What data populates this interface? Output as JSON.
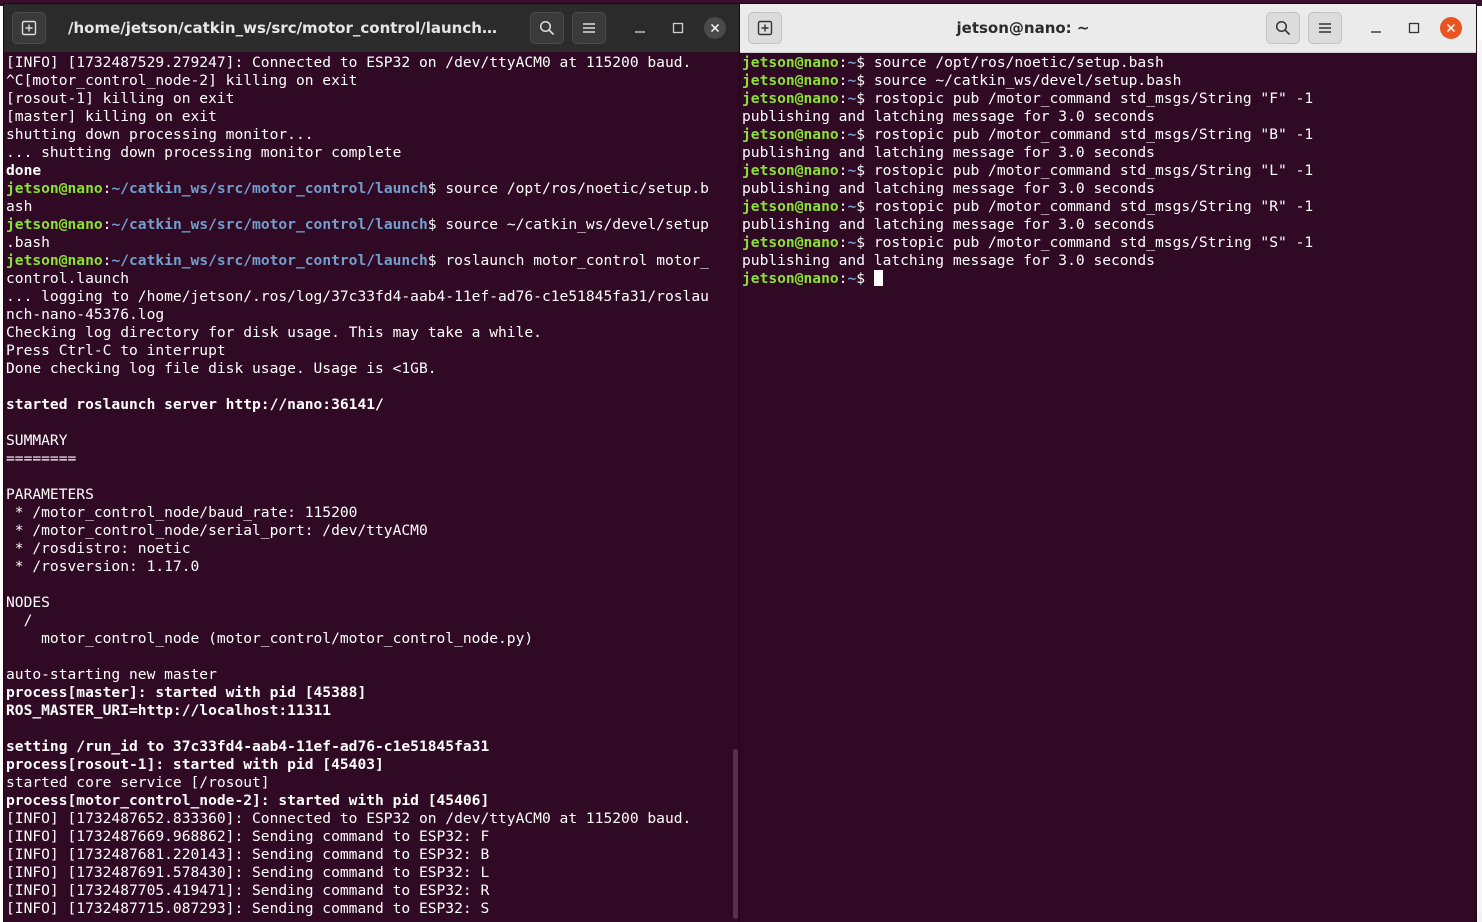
{
  "left_window": {
    "title": "/home/jetson/catkin_ws/src/motor_control/launch/motor_c...",
    "lines": [
      {
        "t": "text",
        "s": "[INFO] [1732487529.279247]: Connected to ESP32 on /dev/ttyACM0 at 115200 baud."
      },
      {
        "t": "text",
        "s": "^C[motor_control_node-2] killing on exit"
      },
      {
        "t": "text",
        "s": "[rosout-1] killing on exit"
      },
      {
        "t": "text",
        "s": "[master] killing on exit"
      },
      {
        "t": "text",
        "s": "shutting down processing monitor..."
      },
      {
        "t": "text",
        "s": "... shutting down processing monitor complete"
      },
      {
        "t": "bold",
        "s": "done"
      },
      {
        "t": "prompt",
        "user": "jetson@nano",
        "path": "~/catkin_ws/src/motor_control/launch",
        "cmd": " source /opt/ros/noetic/setup.b"
      },
      {
        "t": "text",
        "s": "ash"
      },
      {
        "t": "prompt",
        "user": "jetson@nano",
        "path": "~/catkin_ws/src/motor_control/launch",
        "cmd": " source ~/catkin_ws/devel/setup"
      },
      {
        "t": "text",
        "s": ".bash"
      },
      {
        "t": "prompt",
        "user": "jetson@nano",
        "path": "~/catkin_ws/src/motor_control/launch",
        "cmd": " roslaunch motor_control motor_"
      },
      {
        "t": "text",
        "s": "control.launch"
      },
      {
        "t": "text",
        "s": "... logging to /home/jetson/.ros/log/37c33fd4-aab4-11ef-ad76-c1e51845fa31/roslau"
      },
      {
        "t": "text",
        "s": "nch-nano-45376.log"
      },
      {
        "t": "text",
        "s": "Checking log directory for disk usage. This may take a while."
      },
      {
        "t": "text",
        "s": "Press Ctrl-C to interrupt"
      },
      {
        "t": "text",
        "s": "Done checking log file disk usage. Usage is <1GB."
      },
      {
        "t": "text",
        "s": ""
      },
      {
        "t": "bold",
        "s": "started roslaunch server http://nano:36141/"
      },
      {
        "t": "text",
        "s": ""
      },
      {
        "t": "text",
        "s": "SUMMARY"
      },
      {
        "t": "text",
        "s": "========"
      },
      {
        "t": "text",
        "s": ""
      },
      {
        "t": "text",
        "s": "PARAMETERS"
      },
      {
        "t": "text",
        "s": " * /motor_control_node/baud_rate: 115200"
      },
      {
        "t": "text",
        "s": " * /motor_control_node/serial_port: /dev/ttyACM0"
      },
      {
        "t": "text",
        "s": " * /rosdistro: noetic"
      },
      {
        "t": "text",
        "s": " * /rosversion: 1.17.0"
      },
      {
        "t": "text",
        "s": ""
      },
      {
        "t": "text",
        "s": "NODES"
      },
      {
        "t": "text",
        "s": "  /"
      },
      {
        "t": "text",
        "s": "    motor_control_node (motor_control/motor_control_node.py)"
      },
      {
        "t": "text",
        "s": ""
      },
      {
        "t": "text",
        "s": "auto-starting new master"
      },
      {
        "t": "bold",
        "s": "process[master]: started with pid [45388]"
      },
      {
        "t": "bold",
        "s": "ROS_MASTER_URI=http://localhost:11311"
      },
      {
        "t": "text",
        "s": ""
      },
      {
        "t": "bold",
        "s": "setting /run_id to 37c33fd4-aab4-11ef-ad76-c1e51845fa31"
      },
      {
        "t": "bold",
        "s": "process[rosout-1]: started with pid [45403]"
      },
      {
        "t": "text",
        "s": "started core service [/rosout]"
      },
      {
        "t": "bold",
        "s": "process[motor_control_node-2]: started with pid [45406]"
      },
      {
        "t": "text",
        "s": "[INFO] [1732487652.833360]: Connected to ESP32 on /dev/ttyACM0 at 115200 baud."
      },
      {
        "t": "text",
        "s": "[INFO] [1732487669.968862]: Sending command to ESP32: F"
      },
      {
        "t": "text",
        "s": "[INFO] [1732487681.220143]: Sending command to ESP32: B"
      },
      {
        "t": "text",
        "s": "[INFO] [1732487691.578430]: Sending command to ESP32: L"
      },
      {
        "t": "text",
        "s": "[INFO] [1732487705.419471]: Sending command to ESP32: R"
      },
      {
        "t": "text",
        "s": "[INFO] [1732487715.087293]: Sending command to ESP32: S"
      }
    ]
  },
  "right_window": {
    "title": "jetson@nano: ~",
    "lines": [
      {
        "t": "prompt",
        "user": "jetson@nano",
        "path": "~",
        "cmd": " source /opt/ros/noetic/setup.bash"
      },
      {
        "t": "prompt",
        "user": "jetson@nano",
        "path": "~",
        "cmd": " source ~/catkin_ws/devel/setup.bash"
      },
      {
        "t": "prompt",
        "user": "jetson@nano",
        "path": "~",
        "cmd": " rostopic pub /motor_command std_msgs/String \"F\" -1"
      },
      {
        "t": "text",
        "s": "publishing and latching message for 3.0 seconds"
      },
      {
        "t": "prompt",
        "user": "jetson@nano",
        "path": "~",
        "cmd": " rostopic pub /motor_command std_msgs/String \"B\" -1"
      },
      {
        "t": "text",
        "s": "publishing and latching message for 3.0 seconds"
      },
      {
        "t": "prompt",
        "user": "jetson@nano",
        "path": "~",
        "cmd": " rostopic pub /motor_command std_msgs/String \"L\" -1"
      },
      {
        "t": "text",
        "s": "publishing and latching message for 3.0 seconds"
      },
      {
        "t": "prompt",
        "user": "jetson@nano",
        "path": "~",
        "cmd": " rostopic pub /motor_command std_msgs/String \"R\" -1"
      },
      {
        "t": "text",
        "s": "publishing and latching message for 3.0 seconds"
      },
      {
        "t": "prompt",
        "user": "jetson@nano",
        "path": "~",
        "cmd": " rostopic pub /motor_command std_msgs/String \"S\" -1"
      },
      {
        "t": "text",
        "s": "publishing and latching message for 3.0 seconds"
      },
      {
        "t": "prompt",
        "user": "jetson@nano",
        "path": "~",
        "cmd": " ",
        "cursor": true
      }
    ]
  },
  "colors": {
    "terminal_bg": "#300a24",
    "prompt_user": "#8ae234",
    "prompt_path": "#729fcf",
    "close_active": "#e95420"
  },
  "icons": {
    "new_tab": "new-tab-icon",
    "search": "search-icon",
    "menu": "hamburger-menu-icon",
    "minimize": "minimize-icon",
    "maximize": "maximize-icon",
    "close": "close-icon"
  }
}
